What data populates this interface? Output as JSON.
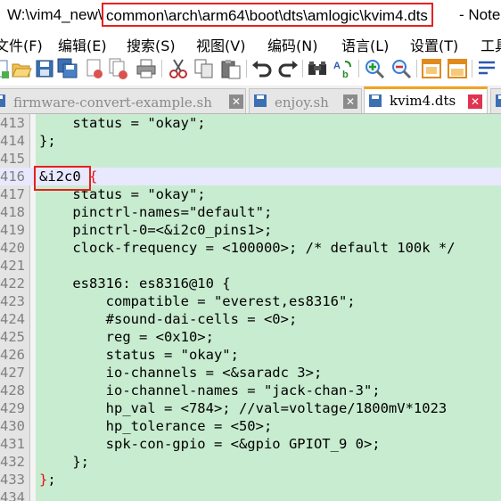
{
  "window": {
    "title_prefix": "W:\\vim4_new\\",
    "title_highlighted": "common\\arch\\arm64\\boot\\dts\\amlogic\\kvim4.dts",
    "title_suffix": " - Note"
  },
  "menu": {
    "items": [
      "文件(F)",
      "编辑(E)",
      "搜索(S)",
      "视图(V)",
      "编码(N)",
      "语言(L)",
      "设置(T)",
      "工具"
    ]
  },
  "toolbar": {
    "icons": [
      "new-file-icon",
      "open-file-icon",
      "save-icon",
      "save-all-icon",
      "close-icon",
      "close-all-icon",
      "print-icon",
      "cut-icon",
      "copy-icon",
      "paste-icon",
      "undo-icon",
      "redo-icon",
      "find-icon",
      "replace-icon",
      "zoom-in-icon",
      "zoom-out-icon",
      "sync-vertical-icon",
      "sync-horizontal-icon",
      "word-wrap-icon"
    ]
  },
  "tabs": [
    {
      "label": "firmware-convert-example.sh",
      "close": "✕",
      "active": false
    },
    {
      "label": "enjoy.sh",
      "close": "✕",
      "active": false
    },
    {
      "label": "kvim4.dts",
      "close": "✕",
      "active": true
    }
  ],
  "colors": {
    "editor_bg": "#c8ecd0",
    "annotation_red": "#e8201e",
    "active_tab_accent": "#f4a21c"
  },
  "editor": {
    "lines": [
      {
        "num": "413",
        "text": "    status = \"okay\";"
      },
      {
        "num": "414",
        "text": "};"
      },
      {
        "num": "415",
        "text": ""
      },
      {
        "num": "416",
        "text": "&i2c0 {"
      },
      {
        "num": "417",
        "text": "    status = \"okay\";"
      },
      {
        "num": "418",
        "text": "    pinctrl-names=\"default\";"
      },
      {
        "num": "419",
        "text": "    pinctrl-0=<&i2c0_pins1>;"
      },
      {
        "num": "420",
        "text": "    clock-frequency = <100000>; /* default 100k */"
      },
      {
        "num": "421",
        "text": ""
      },
      {
        "num": "422",
        "text": "    es8316: es8316@10 {"
      },
      {
        "num": "423",
        "text": "        compatible = \"everest,es8316\";"
      },
      {
        "num": "424",
        "text": "        #sound-dai-cells = <0>;"
      },
      {
        "num": "425",
        "text": "        reg = <0x10>;"
      },
      {
        "num": "426",
        "text": "        status = \"okay\";"
      },
      {
        "num": "427",
        "text": "        io-channels = <&saradc 3>;"
      },
      {
        "num": "428",
        "text": "        io-channel-names = \"jack-chan-3\";"
      },
      {
        "num": "429",
        "text": "        hp_val = <784>; //val=voltage/1800mV*1023"
      },
      {
        "num": "430",
        "text": "        hp_tolerance = <50>;"
      },
      {
        "num": "431",
        "text": "        spk-con-gpio = <&gpio GPIOT_9 0>;"
      },
      {
        "num": "432",
        "text": "    };"
      },
      {
        "num": "433",
        "text": "};"
      },
      {
        "num": "434",
        "text": ""
      }
    ]
  }
}
